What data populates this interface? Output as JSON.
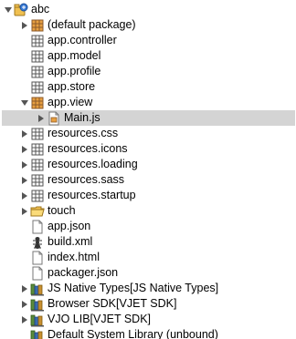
{
  "tree": {
    "project": {
      "label": "abc",
      "icon": "js-project-icon",
      "state": "expanded"
    },
    "items": [
      {
        "label": "(default package)",
        "icon": "package-folder-icon",
        "state": "collapsed"
      },
      {
        "label": "app.controller",
        "icon": "package-icon",
        "state": "none"
      },
      {
        "label": "app.model",
        "icon": "package-icon",
        "state": "none"
      },
      {
        "label": "app.profile",
        "icon": "package-icon",
        "state": "none"
      },
      {
        "label": "app.store",
        "icon": "package-icon",
        "state": "none"
      },
      {
        "label": "app.view",
        "icon": "package-folder-icon",
        "state": "expanded"
      },
      {
        "label": "Main.js",
        "icon": "js-file-icon",
        "state": "collapsed",
        "child": true,
        "selected": true
      },
      {
        "label": "resources.css",
        "icon": "package-icon",
        "state": "collapsed"
      },
      {
        "label": "resources.icons",
        "icon": "package-icon",
        "state": "collapsed"
      },
      {
        "label": "resources.loading",
        "icon": "package-icon",
        "state": "collapsed"
      },
      {
        "label": "resources.sass",
        "icon": "package-icon",
        "state": "collapsed"
      },
      {
        "label": "resources.startup",
        "icon": "package-icon",
        "state": "collapsed"
      },
      {
        "label": "touch",
        "icon": "folder-icon",
        "state": "collapsed"
      },
      {
        "label": "app.json",
        "icon": "file-icon",
        "state": "none"
      },
      {
        "label": "build.xml",
        "icon": "ant-file-icon",
        "state": "none"
      },
      {
        "label": "index.html",
        "icon": "file-icon",
        "state": "none"
      },
      {
        "label": "packager.json",
        "icon": "file-icon",
        "state": "none"
      },
      {
        "label": "JS Native Types[JS Native Types]",
        "icon": "library-icon",
        "state": "collapsed"
      },
      {
        "label": "Browser SDK[VJET SDK]",
        "icon": "library-icon",
        "state": "collapsed"
      },
      {
        "label": "VJO LIB[VJET SDK]",
        "icon": "library-icon",
        "state": "collapsed"
      },
      {
        "label": "Default System Library (unbound)",
        "icon": "library-icon",
        "state": "none"
      }
    ]
  },
  "colors": {
    "selection": "#d4d4d4",
    "package_brown": "#8b5a2b",
    "package_orange": "#e8a040",
    "folder_yellow": "#f0c050",
    "twisty": "#555555"
  }
}
